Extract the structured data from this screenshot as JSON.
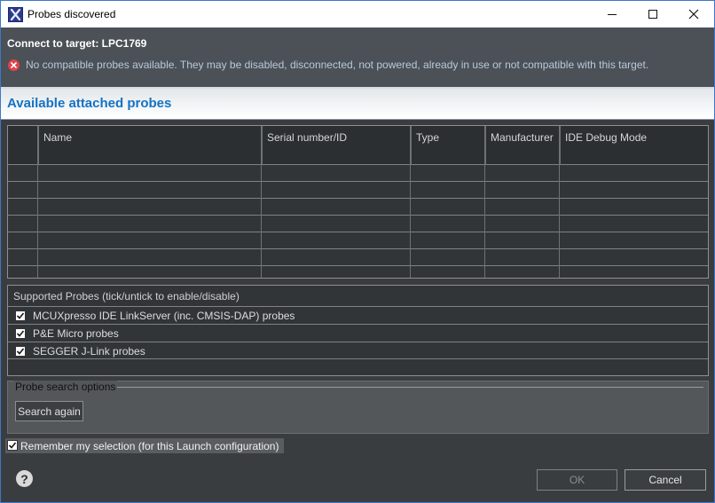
{
  "window": {
    "title": "Probes discovered",
    "app_icon": "app-x-icon",
    "controls": [
      "minimize-icon",
      "maximize-icon",
      "close-icon"
    ]
  },
  "header": {
    "title": "Connect to target: LPC1769",
    "error_icon": "error-icon",
    "message": "No compatible probes available. They may be disabled, disconnected, not powered, already in use or not compatible with this target."
  },
  "section": {
    "title": "Available attached probes"
  },
  "probe_table": {
    "columns": [
      "Name",
      "Serial number/ID",
      "Type",
      "Manufacturer",
      "IDE Debug Mode"
    ],
    "rows": []
  },
  "supported_probes": {
    "label": "Supported Probes (tick/untick to enable/disable)",
    "items": [
      {
        "label": "MCUXpresso IDE LinkServer (inc. CMSIS-DAP) probes",
        "checked": true
      },
      {
        "label": "P&E Micro probes",
        "checked": true
      },
      {
        "label": "SEGGER J-Link probes",
        "checked": true
      }
    ]
  },
  "search_options": {
    "legend": "Probe search options",
    "search_button": "Search again"
  },
  "remember": {
    "label": "Remember my selection (for this Launch configuration)",
    "checked": true
  },
  "footer": {
    "help_icon": "help-icon",
    "help_glyph": "?",
    "ok_label": "OK",
    "ok_enabled": false,
    "cancel_label": "Cancel"
  },
  "colors": {
    "accent": "#1373c4",
    "error": "#e0434b",
    "background": "#3a3d40"
  }
}
